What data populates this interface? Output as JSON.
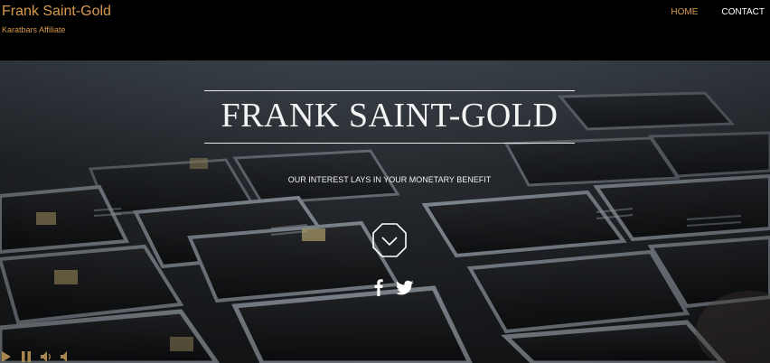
{
  "header": {
    "site_title": "Frank Saint-Gold",
    "site_subtitle": "Karatbars Affiliate"
  },
  "nav": {
    "items": [
      {
        "label": "HOME",
        "active": true
      },
      {
        "label": "CONTACT",
        "active": false
      }
    ]
  },
  "hero": {
    "title": "FRANK SAINT-GOLD",
    "tagline": "OUR INTEREST LAYS IN YOUR MONETARY BENEFIT",
    "scroll_icon": "chevron-down-octagon-icon"
  },
  "social": {
    "icons": [
      "facebook-icon",
      "twitter-icon"
    ]
  },
  "player": {
    "icons": [
      "play-icon",
      "pause-icon",
      "volume-icon",
      "mute-icon"
    ]
  },
  "colors": {
    "accent": "#d99a4f",
    "header_bg": "#000000",
    "text_light": "#ffffff"
  }
}
